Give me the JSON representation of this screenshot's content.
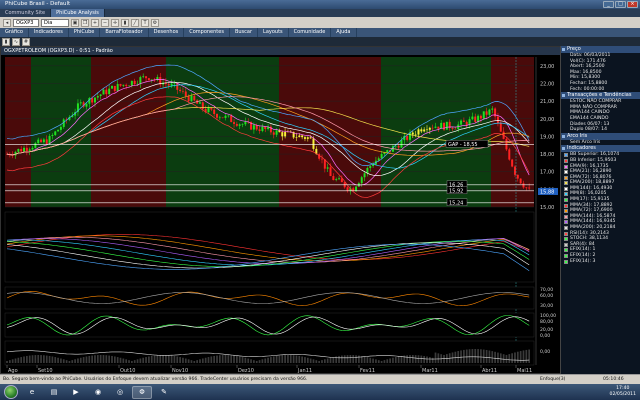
{
  "window": {
    "title": "PhiCube Brasil - Default"
  },
  "tabs": [
    {
      "label": "Community Site"
    },
    {
      "label": "PhiCube Analysis"
    }
  ],
  "toolbar": {
    "ticker": "OGXP3",
    "period": "Dia"
  },
  "menu": [
    {
      "label": "Gráfico"
    },
    {
      "label": "Indicadores"
    },
    {
      "label": "PhiCube"
    },
    {
      "label": "BarraFloteador"
    },
    {
      "label": "Desenhos"
    },
    {
      "label": "Componentes"
    },
    {
      "label": "Buscar"
    },
    {
      "label": "Layouts"
    },
    {
      "label": "Comunidade"
    },
    {
      "label": "Ajuda"
    }
  ],
  "chart_header": "OGXPETROLEOM (OGXP3.D) - 0:51 - Padrão",
  "chart_data": {
    "type": "candlestick",
    "y_ticks": [
      "23,00",
      "22,00",
      "21,00",
      "20,00",
      "19,00",
      "18,00",
      "17,00",
      "16,00",
      "15,00"
    ],
    "x_ticks": [
      "Ago",
      "Set10",
      "Out10",
      "Nov10",
      "Dez10",
      "Jan11",
      "Fev11",
      "Mar11",
      "Abr11",
      "Mai11"
    ],
    "annotations": [
      {
        "label": "GAP - 18,55",
        "y": 18.55
      },
      {
        "label": "16,26",
        "y": 16.26
      },
      {
        "label": "15,92",
        "y": 15.92
      },
      {
        "label": "15,24",
        "y": 15.24
      }
    ],
    "current_price_label": "15,88",
    "ind1_ticks": [
      "70,00",
      "60,00",
      "30,00"
    ],
    "ind2_ticks": [
      "100,00",
      "80,00",
      "20,00",
      "0,00"
    ],
    "ind3_ticks": [
      "0,00"
    ],
    "colors": {
      "up": "#21e021",
      "down": "#ff2222",
      "gap": "#f6ef3a",
      "bull_zone": "#0b3d10",
      "bear_zone": "#4a0a0a"
    }
  },
  "side_panel": {
    "preco_title": "Preço",
    "preco_rows": [
      "Data: 06/03/2011",
      "Vol(C): 171.476",
      "Abert: 16,2500",
      "Max: 16,8500",
      "Min: 15,8300",
      "Fechar: 15,8800",
      "Fech: 00:00:00"
    ],
    "tend_title": "Transacções e Tendências",
    "tend_rows": [
      "ESTOC NÃO COMPRAR",
      "MMA NÃO COMPRAR",
      "MMA144 CAINDO",
      "EMA144 CAINDO",
      "Díades 06/07: 13",
      "Duplo 08/07: 14"
    ],
    "arco_title": "Arco Iris",
    "arco_rows": [
      "Sem Arco Iris"
    ],
    "ind_title": "Indicadores",
    "ind_rows": [
      {
        "label": "BB Superior: 16,1074",
        "color": "#4ea7ff"
      },
      {
        "label": "BB Inferior: 15,9503",
        "color": "#ff3b3b"
      },
      {
        "label": "EMA(9): 16,1735",
        "color": "#ff6bff"
      },
      {
        "label": "EMA(21): 16,2890",
        "color": "#ffffff"
      },
      {
        "label": "EMA(72): 16,8076",
        "color": "#ffa020"
      },
      {
        "label": "EMA(200): 18,8897",
        "color": "#f4e04c"
      },
      {
        "label": "MM(144): 16,4930",
        "color": "#ffffff"
      },
      {
        "label": "MM(8): 16,0205",
        "color": "#30d0ff"
      },
      {
        "label": "MM(17): 15,9135",
        "color": "#37ff48"
      },
      {
        "label": "MMA(34): 17,8892",
        "color": "#ff3333"
      },
      {
        "label": "MMA(72): 17,6900",
        "color": "#ff9900"
      },
      {
        "label": "MMA(144): 16,5874",
        "color": "#ff99aa"
      },
      {
        "label": "MMA(144): 16,9345",
        "color": "#b060ff"
      },
      {
        "label": "MMA(200): 20,2184",
        "color": "#e0e0e0"
      },
      {
        "label": "RSI(14): 30,2143",
        "color": "#ff4444"
      },
      {
        "label": "STOCH: 38,1134",
        "color": "#37ff48"
      },
      {
        "label": "SAR(4): 84",
        "color": "#cccccc"
      },
      {
        "label": "EFIX(14): 1",
        "color": "#37ff48"
      },
      {
        "label": "EFIX(14): 2",
        "color": "#37ff48"
      },
      {
        "label": "EFIX(14): 3",
        "color": "#37ff48"
      }
    ]
  },
  "status": {
    "left": "Bo. Seguro bem-vindo ao PhiCube. Usuários do Enfoque devem atualizar versão 966. TradeCenter usuários precisam da versão 966.",
    "mid": "Enfoque(3)",
    "right": "05:10:46"
  },
  "taskbar": {
    "apps": [
      {
        "icon": "ie-icon",
        "glyph": "e"
      },
      {
        "icon": "folder-icon",
        "glyph": "▤"
      },
      {
        "icon": "media-icon",
        "glyph": "▶"
      },
      {
        "icon": "firefox-icon",
        "glyph": "◉"
      },
      {
        "icon": "chrome-icon",
        "glyph": "◎"
      },
      {
        "icon": "phicube-icon",
        "glyph": "Φ"
      },
      {
        "icon": "paint-icon",
        "glyph": "✎"
      }
    ],
    "time": "17:40",
    "date": "02/05/2011"
  }
}
